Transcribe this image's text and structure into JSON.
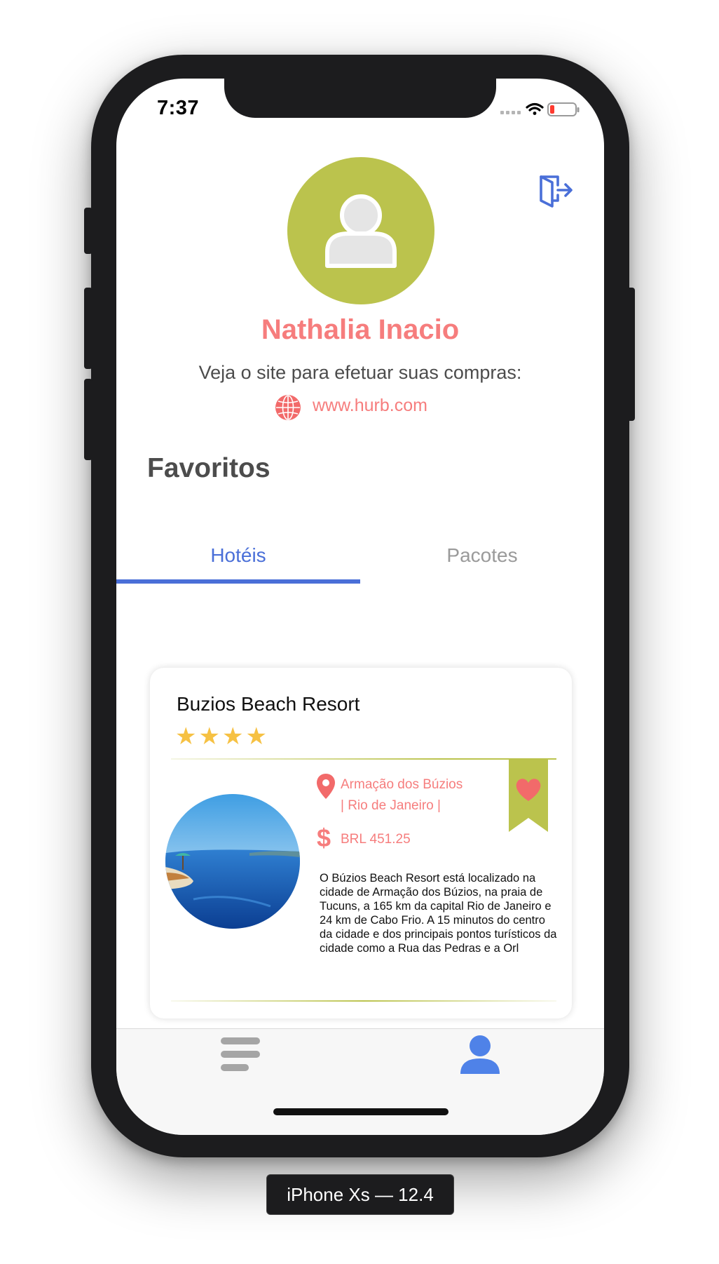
{
  "status_bar": {
    "time": "7:37",
    "battery_level_fraction": 0.12
  },
  "profile": {
    "name": "Nathalia Inacio",
    "site_prompt": "Veja o site para efetuar suas compras:",
    "site_url": "www.hurb.com"
  },
  "favorites": {
    "title": "Favoritos",
    "tabs": [
      {
        "label": "Hotéis",
        "active": true
      },
      {
        "label": "Pacotes",
        "active": false
      }
    ]
  },
  "hotel_card": {
    "name": "Buzios Beach Resort",
    "stars_text": "★★★★",
    "star_rating": 4,
    "location_line1": "Armação dos Búzios",
    "location_line2": "| Rio de Janeiro |",
    "currency_symbol": "$",
    "price": "BRL 451.25",
    "description": "O Búzios Beach Resort está localizado na cidade de Armação dos Búzios, na praia de Tucuns, a 165 km da capital Rio de Janeiro e 24 km de Cabo Frio. A 15 minutos do centro da cidade e dos principais pontos turísticos da cidade como a Rua das Pedras e a Orl",
    "favorited": true
  },
  "tab_bar": {
    "items": [
      {
        "icon": "list-icon",
        "active": false
      },
      {
        "icon": "profile-icon",
        "active": true
      }
    ]
  },
  "device_label": "iPhone Xs — 12.4",
  "colors": {
    "accent_blue": "#4a6fd8",
    "name_coral": "#f67d7d",
    "olive": "#bbc34d",
    "star_yellow": "#f6c143",
    "text_gray": "#4c4c4c",
    "inactive_gray": "#9a9a9a",
    "heart_red": "#f26a6a"
  }
}
